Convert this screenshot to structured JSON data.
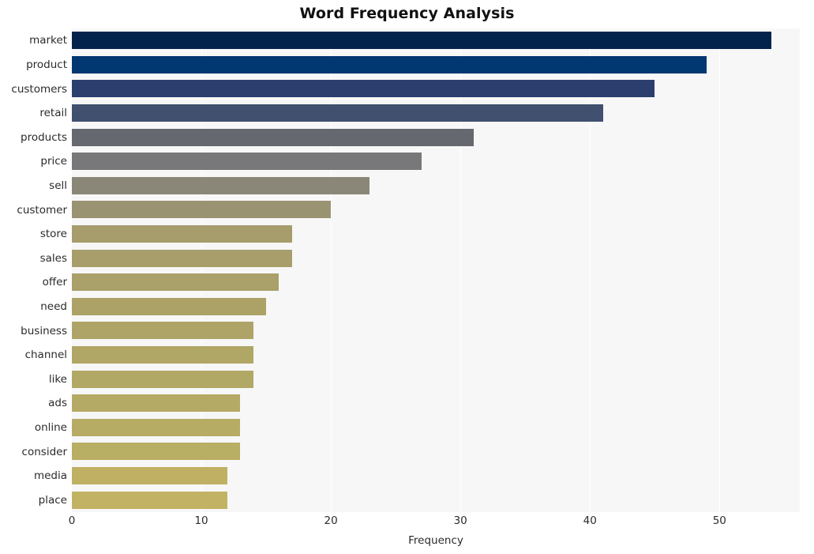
{
  "chart_data": {
    "type": "bar",
    "orientation": "horizontal",
    "title": "Word Frequency Analysis",
    "xlabel": "Frequency",
    "ylabel": "",
    "categories": [
      "market",
      "product",
      "customers",
      "retail",
      "products",
      "price",
      "sell",
      "customer",
      "store",
      "sales",
      "offer",
      "need",
      "business",
      "channel",
      "like",
      "ads",
      "online",
      "consider",
      "media",
      "place"
    ],
    "values": [
      54,
      49,
      45,
      41,
      31,
      27,
      23,
      20,
      17,
      17,
      16,
      15,
      14,
      14,
      14,
      13,
      13,
      13,
      12,
      12
    ],
    "xlim": [
      0,
      56.2
    ],
    "xticks": [
      0,
      10,
      20,
      30,
      40,
      50
    ],
    "xtick_labels": [
      "0",
      "10",
      "20",
      "30",
      "40",
      "50"
    ],
    "grid": true,
    "grid_axis": "x",
    "legend": null,
    "bar_colors": [
      "#04234c",
      "#023871",
      "#2b3e6e",
      "#41506f",
      "#66686f",
      "#78787a",
      "#8b8778",
      "#9a9372",
      "#a69c6c",
      "#a89e6b",
      "#aaa069",
      "#aca268",
      "#aea467",
      "#b0a666",
      "#b2a865",
      "#b4aa65",
      "#b6ac64",
      "#b8ae64",
      "#bfb063",
      "#c2b263"
    ],
    "plot_background": "#f7f7f7",
    "figure_background": "#ffffff",
    "gridline_color": "#ffffff",
    "text_color": "#2b2b2b",
    "title_color": "#111111"
  }
}
